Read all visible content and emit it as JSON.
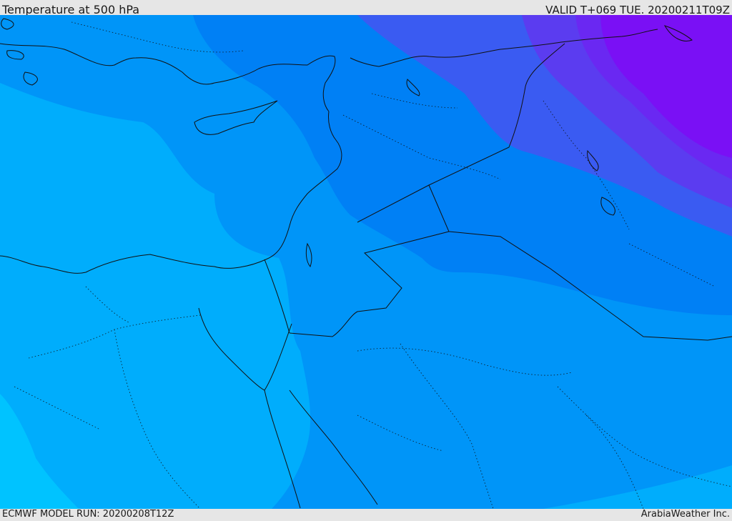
{
  "header": {
    "title": "Temperature at 500 hPa",
    "valid": "VALID T+069 TUE. 20200211T09Z"
  },
  "footer": {
    "model_run": "ECMWF MODEL RUN: 20200208T12Z",
    "credit": "ArabiaWeather Inc."
  },
  "colors": {
    "band_1": "#00c3ff",
    "band_2": "#00adfc",
    "band_3": "#0095f8",
    "band_4": "#0080f5",
    "band_5": "#3a5bf2",
    "band_6": "#5b3cf0",
    "band_7": "#7a10f5",
    "coastline": "#111111"
  }
}
